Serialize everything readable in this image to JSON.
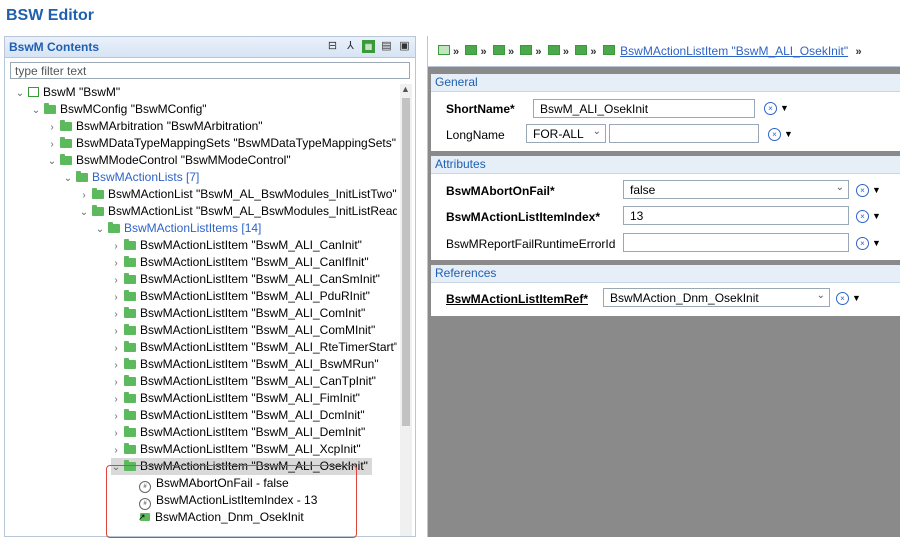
{
  "window": {
    "title": "BSW Editor"
  },
  "left_panel": {
    "title": "BswM Contents",
    "filter_placeholder": "type filter text",
    "tree": [
      {
        "label": "BswM \"BswM\""
      },
      {
        "label": "BswMConfig \"BswMConfig\""
      },
      {
        "label": "BswMArbitration \"BswMArbitration\""
      },
      {
        "label": "BswMDataTypeMappingSets \"BswMDataTypeMappingSets\""
      },
      {
        "label": "BswMModeControl \"BswMModeControl\""
      },
      {
        "label": "BswMActionLists [7]"
      },
      {
        "label": "BswMActionList \"BswM_AL_BswModules_InitListTwo\""
      },
      {
        "label": "BswMActionList \"BswM_AL_BswModules_InitListReadAll\""
      },
      {
        "label": "BswMActionListItems [14]"
      },
      {
        "label": "BswMActionListItem \"BswM_ALI_CanInit\""
      },
      {
        "label": "BswMActionListItem \"BswM_ALI_CanIfInit\""
      },
      {
        "label": "BswMActionListItem \"BswM_ALI_CanSmInit\""
      },
      {
        "label": "BswMActionListItem \"BswM_ALI_PduRInit\""
      },
      {
        "label": "BswMActionListItem \"BswM_ALI_ComInit\""
      },
      {
        "label": "BswMActionListItem \"BswM_ALI_ComMInit\""
      },
      {
        "label": "BswMActionListItem \"BswM_ALI_RteTimerStart\""
      },
      {
        "label": "BswMActionListItem \"BswM_ALI_BswMRun\""
      },
      {
        "label": "BswMActionListItem \"BswM_ALI_CanTpInit\""
      },
      {
        "label": "BswMActionListItem \"BswM_ALI_FimInit\""
      },
      {
        "label": "BswMActionListItem \"BswM_ALI_DcmInit\""
      },
      {
        "label": "BswMActionListItem \"BswM_ALI_DemInit\""
      },
      {
        "label": "BswMActionListItem \"BswM_ALI_XcpInit\""
      },
      {
        "label": "BswMActionListItem \"BswM_ALI_OsekInit\""
      },
      {
        "label": "BswMAbortOnFail - false"
      },
      {
        "label": "BswMActionListItemIndex - 13"
      },
      {
        "label": "BswMAction_Dnm_OsekInit"
      }
    ]
  },
  "right_panel": {
    "breadcrumb_link": "BswMActionListItem \"BswM_ALI_OsekInit\"",
    "general": {
      "title": "General",
      "shortname_label": "ShortName*",
      "shortname_value": "BswM_ALI_OsekInit",
      "longname_label": "LongName",
      "longname_lang": "FOR-ALL",
      "longname_value": ""
    },
    "attributes": {
      "title": "Attributes",
      "abort_label": "BswMAbortOnFail*",
      "abort_value": "false",
      "index_label": "BswMActionListItemIndex*",
      "index_value": "13",
      "report_label": "BswMReportFailRuntimeErrorId",
      "report_value": ""
    },
    "references": {
      "title": "References",
      "ref_label": "BswMActionListItemRef*",
      "ref_value": "BswMAction_Dnm_OsekInit"
    }
  },
  "colors": {
    "accent": "#1f5fb0",
    "link": "#2e63c8",
    "highlight": "#e0443a",
    "folder": "#5db95d"
  }
}
